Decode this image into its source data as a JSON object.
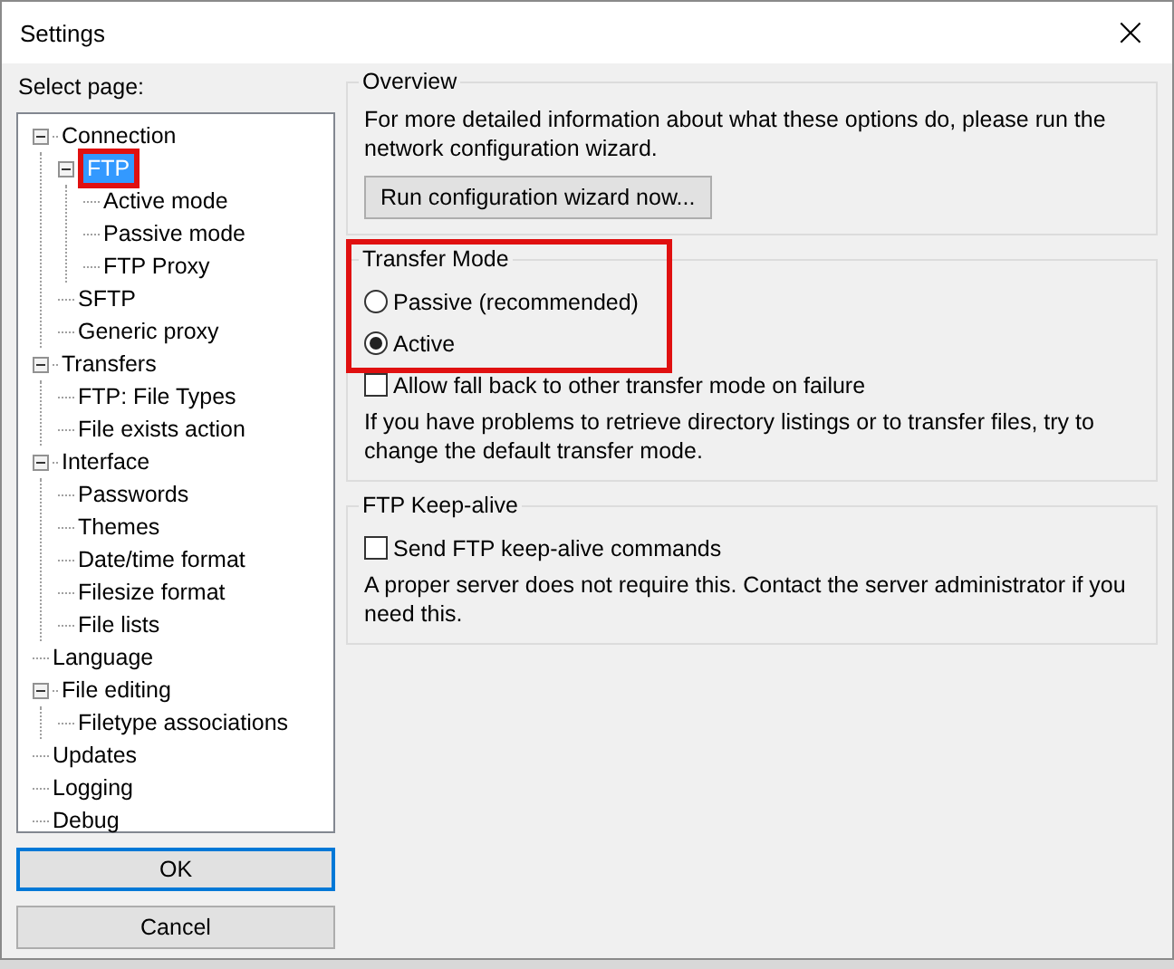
{
  "window": {
    "title": "Settings",
    "close": "×"
  },
  "select_page_label": "Select page:",
  "tree": [
    {
      "label": "Connection",
      "expanded": true,
      "selected": false,
      "highlighted": false,
      "children": [
        {
          "label": "FTP",
          "expanded": true,
          "selected": true,
          "highlighted": true,
          "children": [
            {
              "label": "Active mode",
              "selected": false,
              "highlighted": false
            },
            {
              "label": "Passive mode",
              "selected": false,
              "highlighted": false
            },
            {
              "label": "FTP Proxy",
              "selected": false,
              "highlighted": false
            }
          ]
        },
        {
          "label": "SFTP",
          "selected": false,
          "highlighted": false
        },
        {
          "label": "Generic proxy",
          "selected": false,
          "highlighted": false
        }
      ]
    },
    {
      "label": "Transfers",
      "expanded": true,
      "selected": false,
      "highlighted": false,
      "children": [
        {
          "label": "FTP: File Types",
          "selected": false,
          "highlighted": false
        },
        {
          "label": "File exists action",
          "selected": false,
          "highlighted": false
        }
      ]
    },
    {
      "label": "Interface",
      "expanded": true,
      "selected": false,
      "highlighted": false,
      "children": [
        {
          "label": "Passwords",
          "selected": false,
          "highlighted": false
        },
        {
          "label": "Themes",
          "selected": false,
          "highlighted": false
        },
        {
          "label": "Date/time format",
          "selected": false,
          "highlighted": false
        },
        {
          "label": "Filesize format",
          "selected": false,
          "highlighted": false
        },
        {
          "label": "File lists",
          "selected": false,
          "highlighted": false
        }
      ]
    },
    {
      "label": "Language",
      "selected": false,
      "highlighted": false
    },
    {
      "label": "File editing",
      "expanded": true,
      "selected": false,
      "highlighted": false,
      "children": [
        {
          "label": "Filetype associations",
          "selected": false,
          "highlighted": false
        }
      ]
    },
    {
      "label": "Updates",
      "selected": false,
      "highlighted": false
    },
    {
      "label": "Logging",
      "selected": false,
      "highlighted": false
    },
    {
      "label": "Debug",
      "selected": false,
      "highlighted": false
    }
  ],
  "buttons": [
    {
      "label": "OK",
      "default": true
    },
    {
      "label": "Cancel",
      "default": false
    }
  ],
  "overview": {
    "title": "Overview",
    "text": "For more detailed information about what these options do, please run the network configuration wizard.",
    "button": "Run configuration wizard now..."
  },
  "transfer_mode": {
    "title": "Transfer Mode",
    "highlighted": true,
    "options": [
      {
        "label": "Passive (recommended)",
        "selected": false
      },
      {
        "label": "Active",
        "selected": true
      }
    ],
    "fallback": {
      "label": "Allow fall back to other transfer mode on failure",
      "checked": false
    },
    "text": "If you have problems to retrieve directory listings or to transfer files, try to change the default transfer mode."
  },
  "keep_alive": {
    "title": "FTP Keep-alive",
    "checkbox": {
      "label": "Send FTP keep-alive commands",
      "checked": false
    },
    "text": "A proper server does not require this. Contact the server administrator if you need this."
  }
}
